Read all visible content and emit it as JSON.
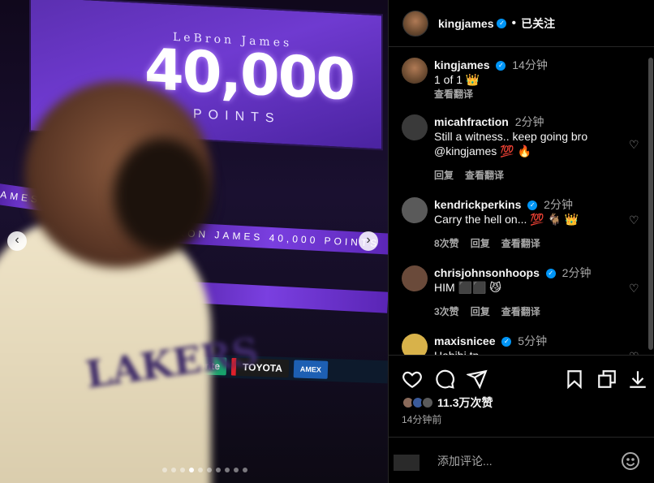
{
  "post": {
    "media": {
      "screen_name": "LeBron James",
      "screen_big": "40,000",
      "screen_sub": "POINTS",
      "ribbon_left": "JAMES   40",
      "ribbon_mid": "LeBRON JAMES   40,000   POINTS",
      "ribbon_low": "40,000",
      "ads": [
        "Sprite",
        "TOYOTA",
        "AMEX"
      ],
      "jersey": "LAKERS",
      "nav_prev": "‹",
      "nav_next": "›",
      "slide_count": 10,
      "active_slide": 3
    },
    "header": {
      "username": "kingjames",
      "separator": "•",
      "follow_label": "已关注"
    },
    "caption": {
      "username": "kingjames",
      "time": "14分钟",
      "text": "1 of 1 👑",
      "translate": "查看翻译"
    },
    "comments": [
      {
        "username": "micahfraction",
        "verified": false,
        "time": "2分钟",
        "text": "Still a witness.. keep going bro @kingjames 💯 🔥",
        "likes": "",
        "reply": "回复",
        "translate": "查看翻译",
        "avatar_color": "#3a3a3a"
      },
      {
        "username": "kendrickperkins",
        "verified": true,
        "time": "2分钟",
        "text": "Carry the hell on... 💯 🐐 👑",
        "likes": "8次赞",
        "reply": "回复",
        "translate": "查看翻译",
        "avatar_color": "#5a5a5a"
      },
      {
        "username": "chrisjohnsonhoops",
        "verified": true,
        "time": "2分钟",
        "text": "HIM ⬛⬛ 😼",
        "likes": "3次赞",
        "reply": "回复",
        "translate": "查看翻译",
        "avatar_color": "#6a4a3a"
      },
      {
        "username": "maxisnicee",
        "verified": true,
        "time": "5分钟",
        "text": "Habibi tp",
        "likes": "",
        "reply": "回复",
        "translate": "查看翻译",
        "avatar_color": "#d8b24a"
      }
    ],
    "actions": {
      "likes": "11.3万次赞",
      "time_ago": "14分钟前"
    },
    "comment_box": {
      "placeholder": "添加评论..."
    },
    "colors": {
      "verified": "#0095f6",
      "secondary_text": "#a8a8a8",
      "background": "#000000"
    }
  }
}
